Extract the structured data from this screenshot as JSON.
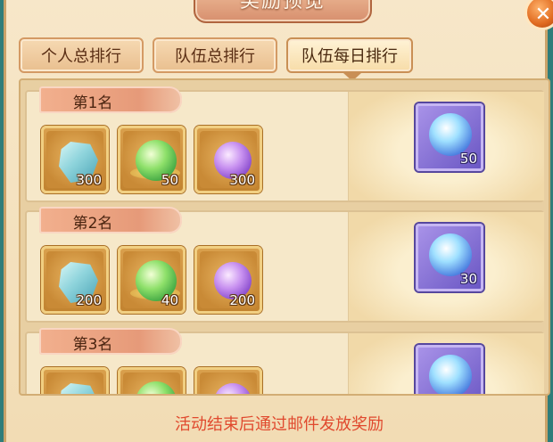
{
  "dialog": {
    "title": "奖励预览",
    "close_icon": "close-x-icon"
  },
  "tabs": [
    {
      "label": "个人总排行",
      "active": false
    },
    {
      "label": "队伍总排行",
      "active": false
    },
    {
      "label": "队伍每日排行",
      "active": true
    }
  ],
  "ranks": [
    {
      "rank_label": "第1名",
      "items": [
        {
          "icon": "crystal-icon",
          "count": "300"
        },
        {
          "icon": "green-orb-icon",
          "count": "50"
        },
        {
          "icon": "purple-orb-icon",
          "count": "300"
        }
      ],
      "special": {
        "icon": "blue-orb-icon",
        "count": "50"
      }
    },
    {
      "rank_label": "第2名",
      "items": [
        {
          "icon": "crystal-icon",
          "count": "200"
        },
        {
          "icon": "green-orb-icon",
          "count": "40"
        },
        {
          "icon": "purple-orb-icon",
          "count": "200"
        }
      ],
      "special": {
        "icon": "blue-orb-icon",
        "count": "30"
      }
    },
    {
      "rank_label": "第3名",
      "items": [
        {
          "icon": "crystal-icon",
          "count": ""
        },
        {
          "icon": "green-orb-icon",
          "count": ""
        },
        {
          "icon": "purple-orb-icon",
          "count": ""
        }
      ],
      "special": {
        "icon": "blue-orb-icon",
        "count": ""
      }
    }
  ],
  "footer": {
    "notice": "活动结束后通过邮件发放奖励"
  },
  "colors": {
    "notice_red": "#e0492e",
    "panel_bg": "#f7e7c9",
    "tab_active": "#fff3d6"
  }
}
